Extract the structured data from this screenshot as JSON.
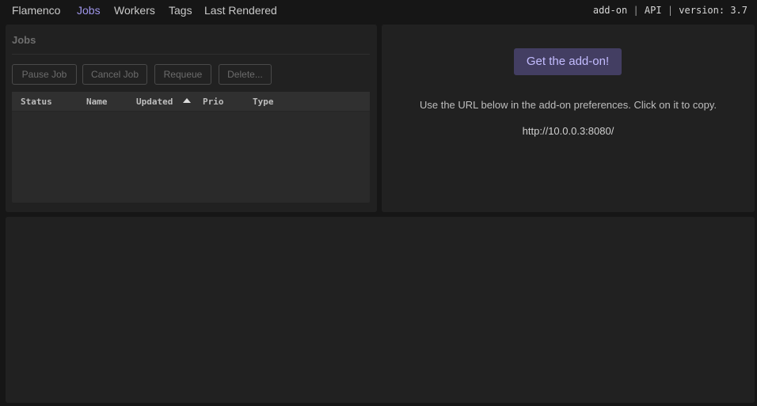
{
  "nav": {
    "items": [
      {
        "label": "Flamenco",
        "active": false
      },
      {
        "label": "Jobs",
        "active": true
      },
      {
        "label": "Workers",
        "active": false
      },
      {
        "label": "Tags",
        "active": false
      },
      {
        "label": "Last Rendered",
        "active": false
      }
    ],
    "addon_link": "add-on",
    "separator": "|",
    "api_link": "API",
    "version_text": "version: 3.7"
  },
  "jobs_panel": {
    "title": "Jobs",
    "buttons": {
      "pause": "Pause Job",
      "cancel": "Cancel Job",
      "requeue": "Requeue",
      "delete": "Delete..."
    },
    "columns": [
      "Status",
      "Name",
      "Updated",
      "Prio",
      "Type"
    ],
    "sorted_column": "Updated",
    "sort_direction": "ascending",
    "rows": []
  },
  "addon_panel": {
    "button_label": "Get the add-on!",
    "instructions": "Use the URL below in the add-on preferences. Click on it to copy.",
    "url": "http://10.0.0.3:8080/"
  },
  "colors": {
    "accent": "#9e95ea",
    "addon_button_bg": "#433e62",
    "panel_bg": "#212121",
    "page_bg": "#161616"
  }
}
